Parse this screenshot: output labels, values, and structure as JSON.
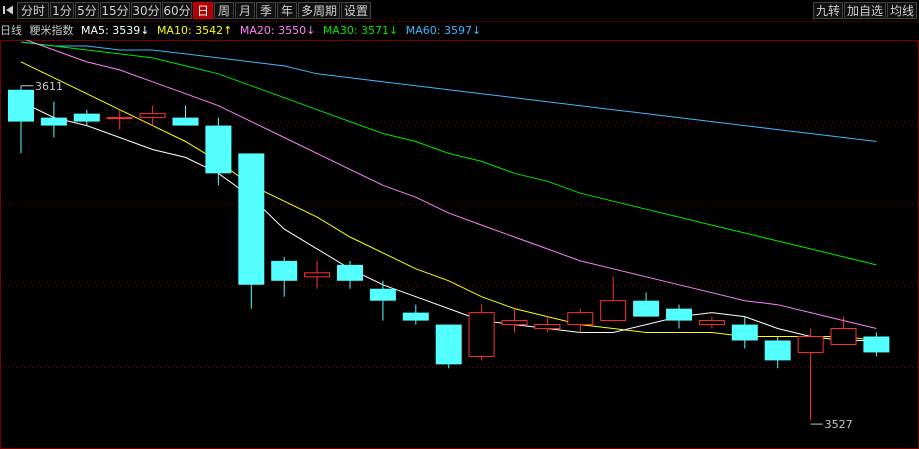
{
  "toolbar": {
    "periods": [
      "分时",
      "1分",
      "5分",
      "15分",
      "30分",
      "60分",
      "日",
      "周",
      "月",
      "季",
      "年",
      "多周期",
      "设置"
    ],
    "active_period": "日",
    "right_buttons": [
      "九转",
      "加自选",
      "均线"
    ]
  },
  "legend": {
    "period": "日线",
    "index_name": "粳米指数",
    "ma5": "MA5: 3539↓",
    "ma10": "MA10: 3542↑",
    "ma20": "MA20: 3550↓",
    "ma30": "MA30: 3571↓",
    "ma60": "MA60: 3597↓"
  },
  "colors": {
    "background": "#000000",
    "up": "#ff3232",
    "down": "#54ffff",
    "grid": "#7a0000",
    "ma5": "#ffffff",
    "ma10": "#ffff00",
    "ma20": "#ff80ff",
    "ma30": "#00e600",
    "ma60": "#3fb8ff",
    "label": "#c8c8c8"
  },
  "chart_data": {
    "type": "candlestick",
    "price_range": [
      3523,
      3622
    ],
    "annotations": [
      {
        "text": "3611",
        "index": 0,
        "price": 3611
      },
      {
        "text": "3527",
        "index": 24,
        "price": 3527
      }
    ],
    "candles": [
      {
        "o": 3610,
        "h": 3611,
        "l": 3594,
        "c": 3602
      },
      {
        "o": 3603,
        "h": 3607,
        "l": 3598,
        "c": 3601
      },
      {
        "o": 3604,
        "h": 3605,
        "l": 3601,
        "c": 3602
      },
      {
        "o": 3603,
        "h": 3605,
        "l": 3600,
        "c": 3603
      },
      {
        "o": 3603,
        "h": 3606,
        "l": 3601,
        "c": 3604
      },
      {
        "o": 3603,
        "h": 3606,
        "l": 3601,
        "c": 3601
      },
      {
        "o": 3601,
        "h": 3603,
        "l": 3586,
        "c": 3589
      },
      {
        "o": 3594,
        "h": 3594,
        "l": 3555,
        "c": 3561
      },
      {
        "o": 3567,
        "h": 3568,
        "l": 3558,
        "c": 3562
      },
      {
        "o": 3563,
        "h": 3567,
        "l": 3560,
        "c": 3564
      },
      {
        "o": 3566,
        "h": 3567,
        "l": 3560,
        "c": 3562
      },
      {
        "o": 3560,
        "h": 3562,
        "l": 3552,
        "c": 3557
      },
      {
        "o": 3554,
        "h": 3556,
        "l": 3551,
        "c": 3552
      },
      {
        "o": 3551,
        "h": 3551,
        "l": 3540,
        "c": 3541
      },
      {
        "o": 3543,
        "h": 3556,
        "l": 3542,
        "c": 3554
      },
      {
        "o": 3551,
        "h": 3555,
        "l": 3549,
        "c": 3552
      },
      {
        "o": 3550,
        "h": 3553,
        "l": 3549,
        "c": 3551
      },
      {
        "o": 3551,
        "h": 3555,
        "l": 3549,
        "c": 3554
      },
      {
        "o": 3552,
        "h": 3563,
        "l": 3552,
        "c": 3557
      },
      {
        "o": 3557,
        "h": 3559,
        "l": 3553,
        "c": 3553
      },
      {
        "o": 3555,
        "h": 3556,
        "l": 3550,
        "c": 3552
      },
      {
        "o": 3551,
        "h": 3553,
        "l": 3550,
        "c": 3552
      },
      {
        "o": 3551,
        "h": 3553,
        "l": 3545,
        "c": 3547
      },
      {
        "o": 3547,
        "h": 3548,
        "l": 3540,
        "c": 3542
      },
      {
        "o": 3544,
        "h": 3550,
        "l": 3527,
        "c": 3548
      },
      {
        "o": 3546,
        "h": 3553,
        "l": 3546,
        "c": 3550
      },
      {
        "o": 3548,
        "h": 3549,
        "l": 3543,
        "c": 3544
      }
    ],
    "ma5": [
      3607,
      3603,
      3601,
      3598,
      3595,
      3593,
      3589,
      3583,
      3575,
      3570,
      3565,
      3561,
      3558,
      3555,
      3552,
      3551,
      3550,
      3549,
      3549,
      3551,
      3553,
      3554,
      3553,
      3550,
      3548,
      3547,
      3547
    ],
    "ma10": [
      3617,
      3613,
      3609,
      3605,
      3601,
      3597,
      3592,
      3586,
      3582,
      3578,
      3573,
      3569,
      3565,
      3562,
      3558,
      3555,
      3553,
      3551,
      3550,
      3549,
      3549,
      3549,
      3548,
      3548,
      3548,
      3548,
      3547
    ],
    "ma20": [
      3623,
      3620,
      3617,
      3615,
      3612,
      3609,
      3606,
      3602,
      3598,
      3594,
      3590,
      3586,
      3583,
      3579,
      3576,
      3573,
      3570,
      3567,
      3565,
      3563,
      3561,
      3559,
      3557,
      3556,
      3554,
      3552,
      3550
    ],
    "ma30": [
      3622,
      3621,
      3620,
      3619,
      3618,
      3616,
      3614,
      3611,
      3608,
      3605,
      3602,
      3599,
      3597,
      3594,
      3592,
      3589,
      3587,
      3584,
      3582,
      3580,
      3578,
      3576,
      3574,
      3572,
      3570,
      3568,
      3566
    ],
    "ma60": [
      3622,
      3621,
      3621,
      3620,
      3620,
      3619,
      3618,
      3617,
      3616,
      3614,
      3613,
      3612,
      3611,
      3610,
      3609,
      3608,
      3607,
      3606,
      3605,
      3604,
      3603,
      3602,
      3601,
      3600,
      3599,
      3598,
      3597
    ]
  }
}
